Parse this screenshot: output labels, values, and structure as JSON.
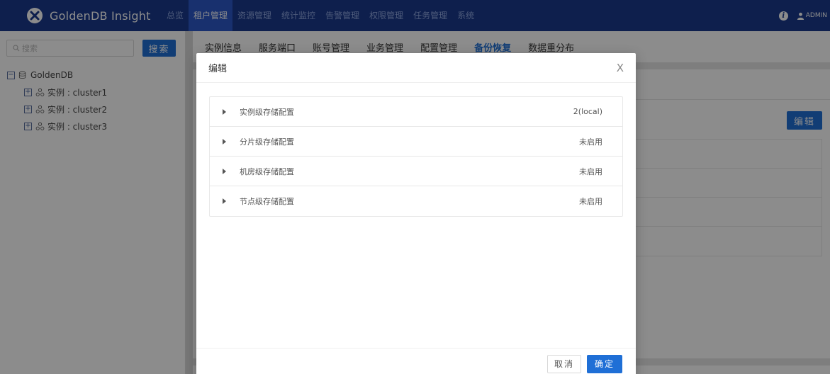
{
  "app": {
    "title": "GoldenDB Insight"
  },
  "nav": {
    "items": [
      {
        "label": "总览"
      },
      {
        "label": "租户管理"
      },
      {
        "label": "资源管理"
      },
      {
        "label": "统计监控"
      },
      {
        "label": "告警管理"
      },
      {
        "label": "权限管理"
      },
      {
        "label": "任务管理"
      },
      {
        "label": "系统"
      }
    ],
    "active_index": 1
  },
  "user": {
    "name": "ADMIN"
  },
  "sidebar": {
    "search_placeholder": "搜索",
    "search_button": "搜索",
    "tree": {
      "root": "GoldenDB",
      "children": [
        {
          "label": "实例 : cluster1"
        },
        {
          "label": "实例 : cluster2"
        },
        {
          "label": "实例 : cluster3"
        }
      ]
    }
  },
  "content": {
    "tabs": [
      {
        "label": "实例信息"
      },
      {
        "label": "服务端口"
      },
      {
        "label": "账号管理"
      },
      {
        "label": "业务管理"
      },
      {
        "label": "配置管理"
      },
      {
        "label": "备份恢复"
      },
      {
        "label": "数据重分布"
      }
    ],
    "active_tab_index": 5,
    "edit_button": "编辑"
  },
  "modal": {
    "title": "编辑",
    "close_glyph": "X",
    "panels": [
      {
        "label": "实例级存储配置",
        "status": "2(local)"
      },
      {
        "label": "分片级存储配置",
        "status": "未启用"
      },
      {
        "label": "机房级存储配置",
        "status": "未启用"
      },
      {
        "label": "节点级存储配置",
        "status": "未启用"
      }
    ],
    "cancel_label": "取消",
    "ok_label": "确定"
  },
  "colors": {
    "topbar": "#1a3a8c",
    "nav_active": "#2d58c9",
    "primary": "#1f6fd6"
  }
}
